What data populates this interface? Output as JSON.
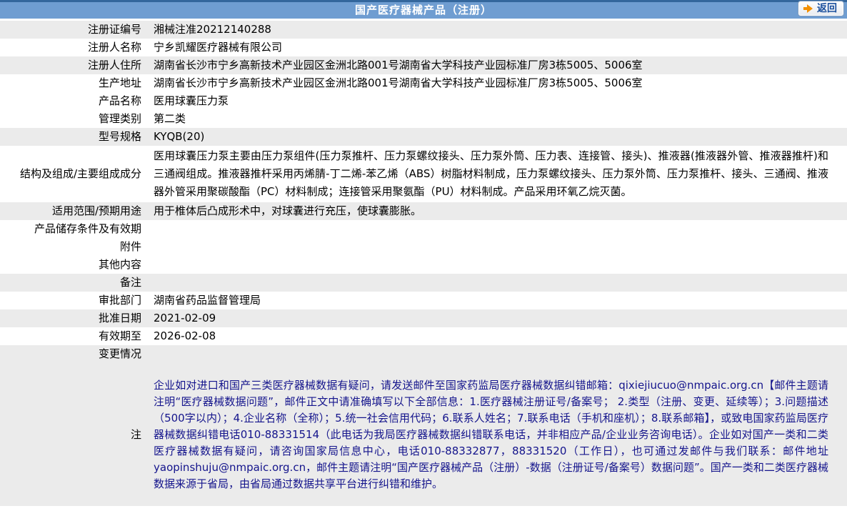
{
  "header": {
    "title": "国产医疗器械产品（注册）",
    "back_label": "返回"
  },
  "colors": {
    "header_bg": "#6f9dd1",
    "header_top_line": "#33669c",
    "shaded_row_bg": "#ebebeb",
    "note_text": "#14148c",
    "back_button_text": "#1a4f9d",
    "back_arrow": "#f39000"
  },
  "table": {
    "rows": [
      {
        "label": "注册证编号",
        "value": "湘械注准20212140288",
        "shaded": true
      },
      {
        "label": "注册人名称",
        "value": "宁乡凯耀医疗器械有限公司",
        "shaded": false
      },
      {
        "label": "注册人住所",
        "value": "湖南省长沙市宁乡高新技术产业园区金洲北路001号湖南省大学科技产业园标准厂房3栋5005、5006室",
        "shaded": true
      },
      {
        "label": "生产地址",
        "value": "湖南省长沙市宁乡高新技术产业园区金洲北路001号湖南省大学科技产业园标准厂房3栋5005、5006室",
        "shaded": false
      },
      {
        "label": "产品名称",
        "value": "医用球囊压力泵",
        "shaded": false
      },
      {
        "label": "管理类别",
        "value": "第二类",
        "shaded": false
      },
      {
        "label": "型号规格",
        "value": "KYQB(20)",
        "shaded": true
      },
      {
        "label": "结构及组成/主要组成成分",
        "value": "医用球囊压力泵主要由压力泵组件(压力泵推杆、压力泵螺纹接头、压力泵外筒、压力表、连接管、接头)、推液器(推液器外管、推液器推杆)和三通阀组成。推液器推杆采用丙烯腈-丁二烯-苯乙烯（ABS）树脂材料制成，压力泵螺纹接头、压力泵外筒、压力泵推杆、接头、三通阀、推液器外管采用聚碳酸酯（PC）材料制成；连接管采用聚氨酯（PU）材料制成。产品采用环氧乙烷灭菌。",
        "shaded": false,
        "tall": true
      },
      {
        "label": "适用范围/预期用途",
        "value": "用于椎体后凸成形术中，对球囊进行充压，使球囊膨胀。",
        "shaded": true
      },
      {
        "label": "产品储存条件及有效期",
        "value": "",
        "shaded": false
      },
      {
        "label": "附件",
        "value": "",
        "shaded": false
      },
      {
        "label": "其他内容",
        "value": "",
        "shaded": false
      },
      {
        "label": "备注",
        "value": "",
        "shaded": true
      },
      {
        "label": "审批部门",
        "value": "湖南省药品监督管理局",
        "shaded": false
      },
      {
        "label": "批准日期",
        "value": "2021-02-09",
        "shaded": true
      },
      {
        "label": "有效期至",
        "value": "2026-02-08",
        "shaded": false
      },
      {
        "label": "变更情况",
        "value": "",
        "shaded": true
      },
      {
        "label": "注",
        "value": "企业如对进口和国产三类医疗器械数据有疑问，请发送邮件至国家药监局医疗器械数据纠错邮箱：qixiejiucuo@nmpaic.org.cn【邮件主题请注明“医疗器械数据问题”，邮件正文中请准确填写以下全部信息：1.医疗器械注册证号/备案号； 2.类型（注册、变更、延续等）；3.问题描述（500字以内）；4.企业名称（全称）；5.统一社会信用代码；6.联系人姓名；7.联系电话（手机和座机）；8.联系邮箱】，或致电国家药监局医疗器械数据纠错电话010-88331514（此电话为我局医疗器械数据纠错联系电话，并非相应产品/企业业务咨询电话）。企业如对国产一类和二类医疗器械数据有疑问，请咨询国家局信息中心，电话010-88332877，88331520（工作日），也可通过发邮件与我们联系：邮件地址yaopinshuju@nmpaic.org.cn，邮件主题请注明“国产医疗器械产品（注册）-数据（注册证号/备案号）数据问题”。国产一类和二类医疗器械数据来源于省局，由省局通过数据共享平台进行纠错和维护。",
        "shaded": true,
        "tall": true,
        "note": true
      }
    ]
  }
}
